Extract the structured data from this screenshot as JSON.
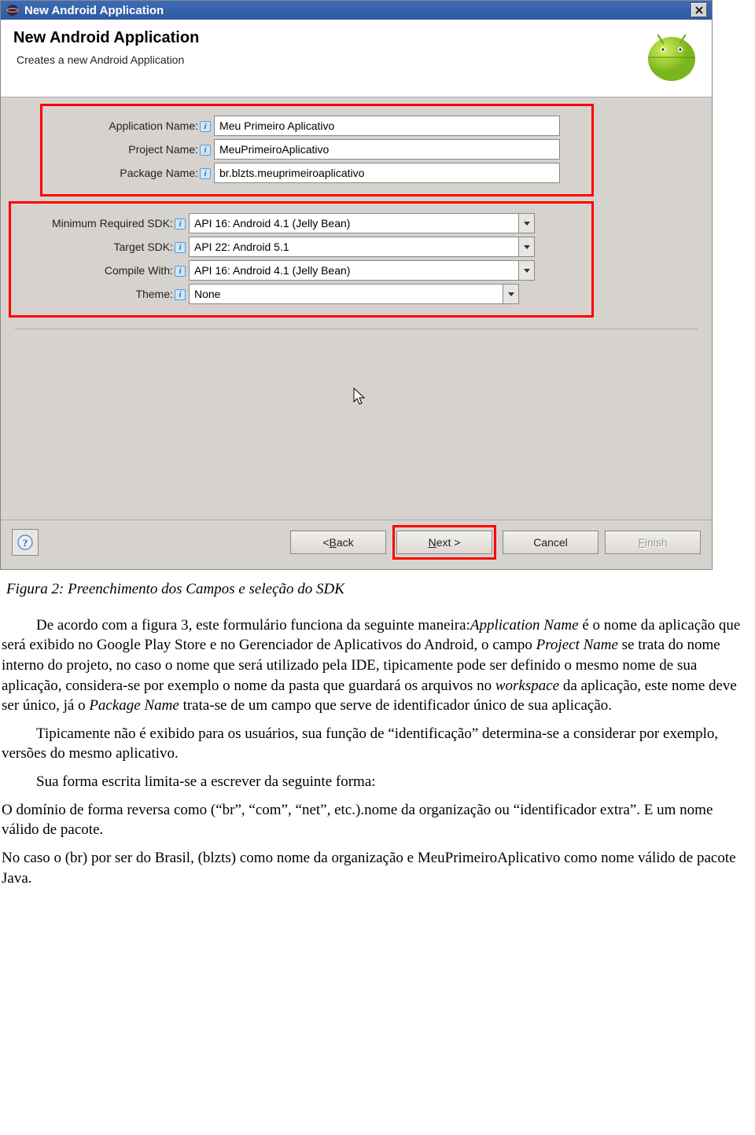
{
  "dialog": {
    "title": "New Android Application",
    "header_title": "New Android Application",
    "header_subtitle": "Creates a new Android Application"
  },
  "fields": {
    "app_name": {
      "label": "Application Name:",
      "value": "Meu Primeiro Aplicativo"
    },
    "project_name": {
      "label": "Project Name:",
      "value": "MeuPrimeiroAplicativo"
    },
    "package_name": {
      "label": "Package Name:",
      "value": "br.blzts.meuprimeiroaplicativo"
    },
    "min_sdk": {
      "label": "Minimum Required SDK:",
      "value": "API 16: Android 4.1 (Jelly Bean)"
    },
    "target_sdk": {
      "label": "Target SDK:",
      "value": "API 22: Android 5.1"
    },
    "compile_with": {
      "label": "Compile With:",
      "value": "API 16: Android 4.1 (Jelly Bean)"
    },
    "theme": {
      "label": "Theme:",
      "value": "None"
    }
  },
  "buttons": {
    "back_prefix": "< ",
    "back_u": "B",
    "back_suffix": "ack",
    "next_u": "N",
    "next_suffix": "ext >",
    "cancel": "Cancel",
    "finish_u": "F",
    "finish_suffix": "inish"
  },
  "doc": {
    "caption": "Figura 2: Preenchimento dos Campos e seleção do SDK",
    "p1a": "De acordo com a figura 3, este formulário funciona da seguinte maneira:",
    "p1b": "Application Name",
    "p1c": " é o nome da aplicação que será exibido no Google Play Store e no Gerenciador de Aplicativos do Android, o campo ",
    "p1d": "Project Name",
    "p1e": " se trata do nome interno do projeto, no caso o nome que será utilizado pela IDE, tipicamente pode ser definido o mesmo nome de sua aplicação, considera-se por exemplo o nome da pasta que guardará os arquivos no ",
    "p1f": "workspace",
    "p1g": " da aplicação, este nome deve ser único, já o ",
    "p1h": "Package Name",
    "p1i": " trata-se de um campo que serve de identificador único de sua aplicação.",
    "p2": "Tipicamente não é exibido para os usuários, sua função de “identificação” determina-se a considerar por exemplo, versões do mesmo aplicativo.",
    "p3": "Sua forma escrita limita-se a escrever da seguinte forma:",
    "p4": "O domínio de forma reversa como (“br”, “com”, “net”, etc.).nome da organização ou “identificador extra”. E um nome válido de pacote.",
    "p5": "No caso o (br) por ser do Brasil, (blzts) como nome da organização e MeuPrimeiroAplicativo como nome válido de pacote Java."
  }
}
